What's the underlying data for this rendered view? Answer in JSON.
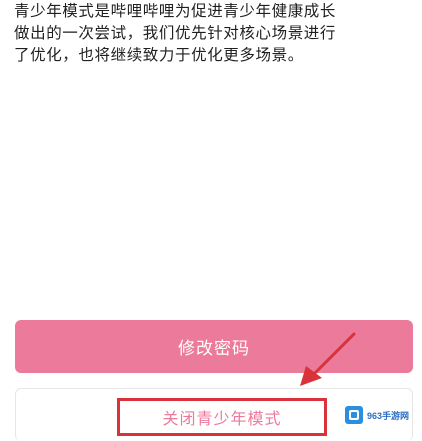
{
  "description": {
    "lines": [
      "青少年模式是哔哩哔哩为促进青少年健康成长",
      "做出的一次尝试，我们优先针对核心场景进行",
      "了优化，也将继续致力于优化更多场景。"
    ]
  },
  "buttons": {
    "change_password": "修改密码",
    "close_teen_mode": "关闭青少年模式"
  },
  "annotation": {
    "highlight_color": "#d9323a",
    "arrow_color": "#d9323a"
  },
  "watermark": {
    "text": "963手游网",
    "logo_icon": "watermark-logo-icon"
  },
  "colors": {
    "accent_pink": "#ec7a9b",
    "text": "#1f1f1f"
  }
}
